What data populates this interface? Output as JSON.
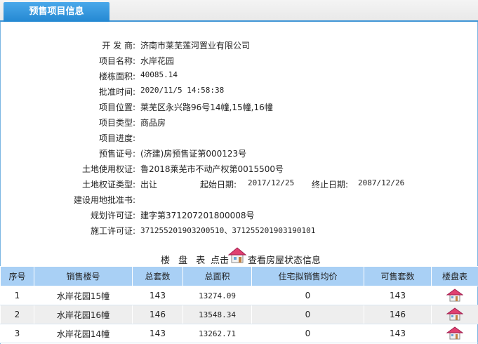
{
  "tab": {
    "label": "预售项目信息"
  },
  "info": {
    "developer": {
      "label": "开 发 商:",
      "value": "济南市莱芜莲河置业有限公司"
    },
    "project_name": {
      "label": "项目名称:",
      "value": "水岸花园"
    },
    "building_area": {
      "label": "楼栋面积:",
      "value": "40085.14"
    },
    "approval_time": {
      "label": "批准时间:",
      "value": "2020/11/5 14:58:38"
    },
    "location": {
      "label": "项目位置:",
      "value": "莱芜区永兴路96号14幢,15幢,16幢"
    },
    "type": {
      "label": "项目类型:",
      "value": "商品房"
    },
    "progress": {
      "label": "项目进度:",
      "value": ""
    },
    "presale_no": {
      "label": "预售证号:",
      "value": "(济建)房预售证第000123号"
    },
    "land_cert": {
      "label": "土地使用权证:",
      "value": "鲁2018莱芜市不动产权第0015500号"
    },
    "land_right_type": {
      "label": "土地权证类型:",
      "value": "出让",
      "start_label": "起始日期:",
      "start_value": "2017/12/25",
      "end_label": "终止日期:",
      "end_value": "2087/12/26"
    },
    "land_approval": {
      "label": "建设用地批准书:",
      "value": ""
    },
    "planning_permit": {
      "label": "规划许可证:",
      "value": "建字第371207201800008号"
    },
    "construction_permit": {
      "label": "施工许可证:",
      "value": "371255201903200510、371255201903190101"
    }
  },
  "list_header": {
    "title": "楼 盘 表",
    "click": "点击",
    "view_status": "查看房屋状态信息"
  },
  "table": {
    "headers": [
      "序号",
      "销售楼号",
      "总套数",
      "总面积",
      "住宅拟销售均价",
      "可售套数",
      "楼盘表"
    ],
    "rows": [
      [
        "1",
        "水岸花园15幢",
        "143",
        "13274.09",
        "0",
        "143"
      ],
      [
        "2",
        "水岸花园16幢",
        "146",
        "13548.34",
        "0",
        "146"
      ],
      [
        "3",
        "水岸花园14幢",
        "143",
        "13262.71",
        "0",
        "143"
      ]
    ]
  },
  "icons": {
    "house": "house-icon"
  },
  "colors": {
    "tab": "#2488d2",
    "header_row": "#a9d0f5",
    "alt_row": "#eeeeee",
    "roof": "#e04070"
  }
}
